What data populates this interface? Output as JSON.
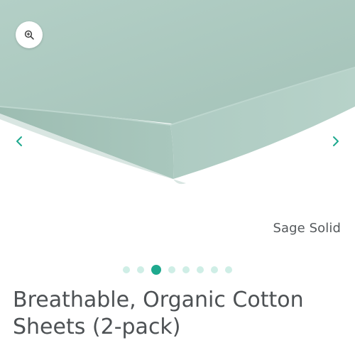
{
  "gallery": {
    "zoom_icon": "zoom-in-icon",
    "prev_icon": "chevron-left-icon",
    "next_icon": "chevron-right-icon",
    "accent_color": "#1ea98e",
    "image_color": "#a9c6bd",
    "total_slides": 8,
    "active_slide": 3
  },
  "product": {
    "variant": "Sage Solid",
    "title": "Breathable, Organic Cotton Sheets (2-pack)"
  }
}
